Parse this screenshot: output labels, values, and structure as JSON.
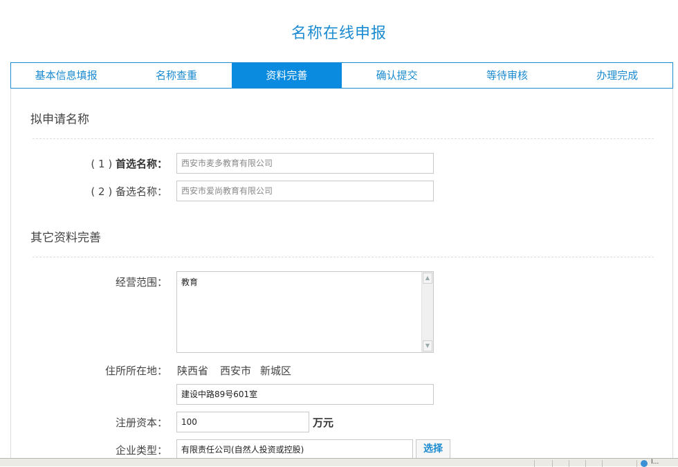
{
  "page": {
    "title": "名称在线申报"
  },
  "tabs": [
    {
      "label": "基本信息填报",
      "active": false
    },
    {
      "label": "名称查重",
      "active": false
    },
    {
      "label": "资料完善",
      "active": true
    },
    {
      "label": "确认提交",
      "active": false
    },
    {
      "label": "等待审核",
      "active": false
    },
    {
      "label": "办理完成",
      "active": false
    }
  ],
  "section1": {
    "title": "拟申请名称",
    "primary": {
      "prefix": "( 1 )",
      "label": "首选名称：",
      "value": "西安市麦多教育有限公司"
    },
    "alternate": {
      "prefix": "( 2 )",
      "label": "备选名称：",
      "value": "西安市爱尚教育有限公司"
    }
  },
  "section2": {
    "title": "其它资料完善",
    "scope": {
      "label": "经营范围：",
      "value": "教育"
    },
    "address": {
      "label": "住所所在地：",
      "province": "陕西省",
      "city": "西安市",
      "district": "新城区",
      "street": "建设中路89号601室"
    },
    "capital": {
      "label": "注册资本：",
      "value": "100",
      "unit": "万元"
    },
    "company_type": {
      "label": "企业类型：",
      "value": "有限责任公司(自然人投资或控股)",
      "button": "选择"
    }
  },
  "statusbar": {
    "text": "I..."
  }
}
